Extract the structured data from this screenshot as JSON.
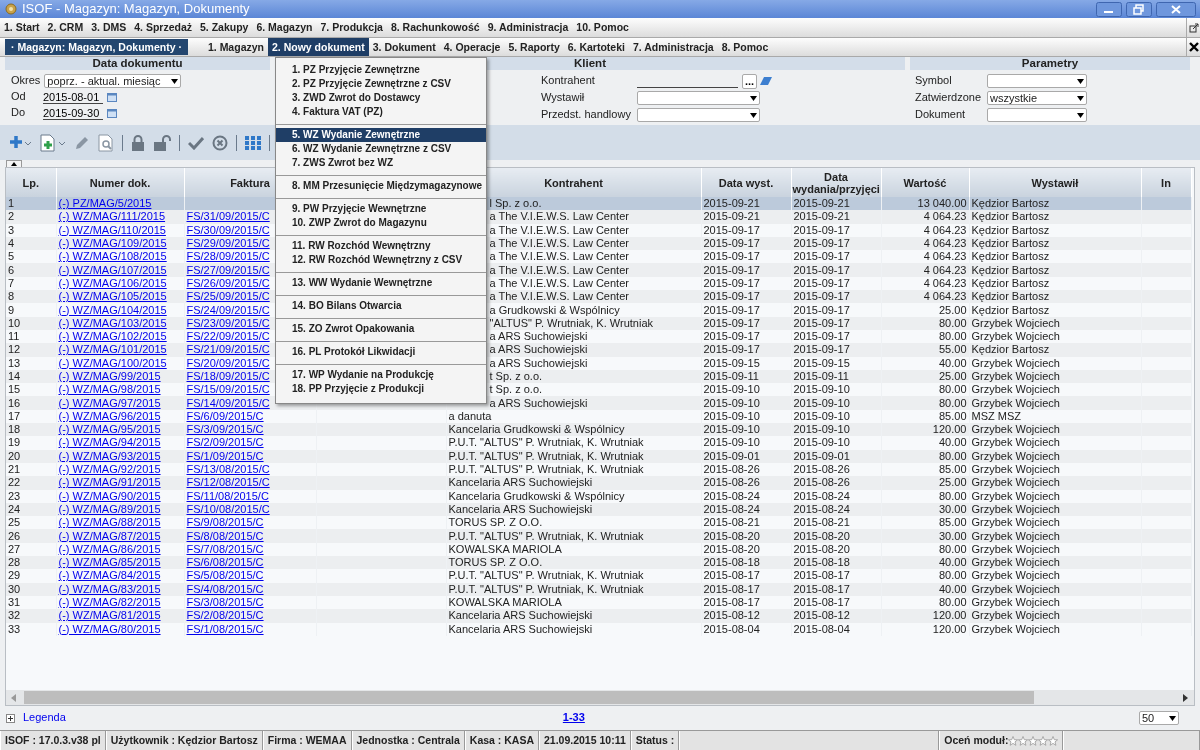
{
  "window": {
    "title": "ISOF - Magazyn: Magazyn, Dokumenty"
  },
  "main_menu": [
    "1. Start",
    "2. CRM",
    "3. DMS",
    "4. Sprzedaż",
    "5. Zakupy",
    "6. Magazyn",
    "7. Produkcja",
    "8. Rachunkowość",
    "9. Administracja",
    "10. Pomoc"
  ],
  "module_tag": "· Magazyn: Magazyn, Dokumenty ·",
  "sub_menu": [
    {
      "label": "1. Magazyn",
      "selected": false
    },
    {
      "label": "2. Nowy dokument",
      "selected": true
    },
    {
      "label": "3. Dokument",
      "selected": false
    },
    {
      "label": "4. Operacje",
      "selected": false
    },
    {
      "label": "5. Raporty",
      "selected": false
    },
    {
      "label": "6. Kartoteki",
      "selected": false
    },
    {
      "label": "7. Administracja",
      "selected": false
    },
    {
      "label": "8. Pomoc",
      "selected": false
    }
  ],
  "dropdown": {
    "groups": [
      [
        {
          "label": "1. PZ Przyjęcie Zewnętrzne",
          "selected": false
        },
        {
          "label": "2. PZ Przyjęcie Zewnętrzne z CSV",
          "selected": false
        },
        {
          "label": "3. ZWD Zwrot do Dostawcy",
          "selected": false
        },
        {
          "label": "4. Faktura VAT (PZ)",
          "selected": false
        }
      ],
      [
        {
          "label": "5. WZ Wydanie Zewnętrzne",
          "selected": true
        },
        {
          "label": "6. WZ Wydanie Zewnętrzne z CSV",
          "selected": false
        },
        {
          "label": "7. ZWS Zwrot bez WZ",
          "selected": false
        }
      ],
      [
        {
          "label": "8. MM Przesunięcie Międzymagazynowe",
          "selected": false
        }
      ],
      [
        {
          "label": "9. PW Przyjęcie Wewnętrzne",
          "selected": false
        },
        {
          "label": "10. ZWP Zwrot do Magazynu",
          "selected": false
        }
      ],
      [
        {
          "label": "11. RW Rozchód Wewnętrzny",
          "selected": false
        },
        {
          "label": "12. RW Rozchód Wewnętrzny z CSV",
          "selected": false
        }
      ],
      [
        {
          "label": "13. WW Wydanie Wewnętrzne",
          "selected": false
        }
      ],
      [
        {
          "label": "14. BO Bilans Otwarcia",
          "selected": false
        }
      ],
      [
        {
          "label": "15. ZO Zwrot Opakowania",
          "selected": false
        }
      ],
      [
        {
          "label": "16. PL Protokół Likwidacji",
          "selected": false
        }
      ],
      [
        {
          "label": "17. WP Wydanie na Produkcję",
          "selected": false
        },
        {
          "label": "18. PP Przyjęcie z Produkcji",
          "selected": false
        }
      ]
    ]
  },
  "filters": {
    "date": {
      "title": "Data dokumentu",
      "period_label": "Okres",
      "period": "poprz. - aktual. miesiąc",
      "from_label": "Od",
      "from": "2015-08-01",
      "to_label": "Do",
      "to": "2015-09-30"
    },
    "client": {
      "title": "Klient",
      "fields": [
        {
          "label": "Kontrahent",
          "kind": "lookup",
          "button": "..."
        },
        {
          "label": "Wystawił",
          "kind": "select"
        },
        {
          "label": "Przedst. handlowy",
          "kind": "select"
        }
      ]
    },
    "params": {
      "title": "Parametry",
      "fields": [
        {
          "label": "Symbol",
          "kind": "select"
        },
        {
          "label": "Zatwierdzone",
          "kind": "select",
          "value": "wszystkie"
        },
        {
          "label": "Dokument",
          "kind": "select"
        }
      ]
    }
  },
  "table": {
    "columns": [
      {
        "label": "Lp.",
        "kind": "text"
      },
      {
        "label": "Numer dok.",
        "kind": "link"
      },
      {
        "label": "Faktura",
        "kind": "link"
      },
      {
        "kind": "blank"
      },
      {
        "label": "Kontrahent",
        "kind": "text"
      },
      {
        "label": "Data wyst.",
        "kind": "text"
      },
      {
        "label": "Data wydania/przyjęci",
        "kind": "text"
      },
      {
        "label": "Wartość",
        "kind": "number"
      },
      {
        "label": "Wystawił",
        "kind": "text"
      },
      {
        "label": "In",
        "kind": "text"
      }
    ],
    "rows": [
      {
        "cells": [
          "1",
          "(-) PZ/MAG/5/2015",
          null,
          null,
          "l Sp. z o.o.",
          "2015-09-21",
          "2015-09-21",
          "13 040.00",
          "Kędzior Bartosz"
        ],
        "selected": true
      },
      {
        "cells": [
          "2",
          "(-) WZ/MAG/111/2015",
          "FS/31/09/2015/C",
          null,
          "a The V.I.E.W.S. Law Center",
          "2015-09-21",
          "2015-09-21",
          "4 064.23",
          "Kędzior Bartosz"
        ],
        "selected": false
      },
      {
        "cells": [
          "3",
          "(-) WZ/MAG/110/2015",
          "FS/30/09/2015/C",
          null,
          "a The V.I.E.W.S. Law Center",
          "2015-09-17",
          "2015-09-17",
          "4 064.23",
          "Kędzior Bartosz"
        ],
        "selected": false
      },
      {
        "cells": [
          "4",
          "(-) WZ/MAG/109/2015",
          "FS/29/09/2015/C",
          null,
          "a The V.I.E.W.S. Law Center",
          "2015-09-17",
          "2015-09-17",
          "4 064.23",
          "Kędzior Bartosz"
        ],
        "selected": false
      },
      {
        "cells": [
          "5",
          "(-) WZ/MAG/108/2015",
          "FS/28/09/2015/C",
          null,
          "a The V.I.E.W.S. Law Center",
          "2015-09-17",
          "2015-09-17",
          "4 064.23",
          "Kędzior Bartosz"
        ],
        "selected": false
      },
      {
        "cells": [
          "6",
          "(-) WZ/MAG/107/2015",
          "FS/27/09/2015/C",
          null,
          "a The V.I.E.W.S. Law Center",
          "2015-09-17",
          "2015-09-17",
          "4 064.23",
          "Kędzior Bartosz"
        ],
        "selected": false
      },
      {
        "cells": [
          "7",
          "(-) WZ/MAG/106/2015",
          "FS/26/09/2015/C",
          null,
          "a The V.I.E.W.S. Law Center",
          "2015-09-17",
          "2015-09-17",
          "4 064.23",
          "Kędzior Bartosz"
        ],
        "selected": false
      },
      {
        "cells": [
          "8",
          "(-) WZ/MAG/105/2015",
          "FS/25/09/2015/C",
          null,
          "a The V.I.E.W.S. Law Center",
          "2015-09-17",
          "2015-09-17",
          "4 064.23",
          "Kędzior Bartosz"
        ],
        "selected": false
      },
      {
        "cells": [
          "9",
          "(-) WZ/MAG/104/2015",
          "FS/24/09/2015/C",
          null,
          "a Grudkowski & Wspólnicy",
          "2015-09-17",
          "2015-09-17",
          "25.00",
          "Kędzior Bartosz"
        ],
        "selected": false
      },
      {
        "cells": [
          "10",
          "(-) WZ/MAG/103/2015",
          "FS/23/09/2015/C",
          null,
          "\"ALTUS\" P. Wrutniak, K. Wrutniak",
          "2015-09-17",
          "2015-09-17",
          "80.00",
          "Grzybek Wojciech"
        ],
        "selected": false
      },
      {
        "cells": [
          "11",
          "(-) WZ/MAG/102/2015",
          "FS/22/09/2015/C",
          null,
          "a ARS Suchowiejski",
          "2015-09-17",
          "2015-09-17",
          "80.00",
          "Grzybek Wojciech"
        ],
        "selected": false
      },
      {
        "cells": [
          "12",
          "(-) WZ/MAG/101/2015",
          "FS/21/09/2015/C",
          null,
          "a ARS Suchowiejski",
          "2015-09-17",
          "2015-09-17",
          "55.00",
          "Kędzior Bartosz"
        ],
        "selected": false
      },
      {
        "cells": [
          "13",
          "(-) WZ/MAG/100/2015",
          "FS/20/09/2015/C",
          null,
          "a ARS Suchowiejski",
          "2015-09-15",
          "2015-09-15",
          "40.00",
          "Grzybek Wojciech"
        ],
        "selected": false
      },
      {
        "cells": [
          "14",
          "(-) WZ/MAG/99/2015",
          "FS/18/09/2015/C",
          null,
          "t Sp. z o.o.",
          "2015-09-11",
          "2015-09-11",
          "25.00",
          "Grzybek Wojciech"
        ],
        "selected": false
      },
      {
        "cells": [
          "15",
          "(-) WZ/MAG/98/2015",
          "FS/15/09/2015/C",
          null,
          "t Sp. z o.o.",
          "2015-09-10",
          "2015-09-10",
          "80.00",
          "Grzybek Wojciech"
        ],
        "selected": false
      },
      {
        "cells": [
          "16",
          "(-) WZ/MAG/97/2015",
          "FS/14/09/2015/C",
          null,
          "a ARS Suchowiejski",
          "2015-09-10",
          "2015-09-10",
          "80.00",
          "Grzybek Wojciech"
        ],
        "selected": false
      },
      {
        "cells": [
          "17",
          "(-) WZ/MAG/96/2015",
          "FS/6/09/2015/C",
          null,
          "a danuta",
          "2015-09-10",
          "2015-09-10",
          "85.00",
          "MSZ MSZ"
        ],
        "selected": false
      },
      {
        "cells": [
          "18",
          "(-) WZ/MAG/95/2015",
          "FS/3/09/2015/C",
          null,
          "Kancelaria Grudkowski & Wspólnicy",
          "2015-09-10",
          "2015-09-10",
          "120.00",
          "Grzybek Wojciech"
        ],
        "selected": false
      },
      {
        "cells": [
          "19",
          "(-) WZ/MAG/94/2015",
          "FS/2/09/2015/C",
          null,
          "P.U.T. \"ALTUS\" P. Wrutniak, K. Wrutniak",
          "2015-09-10",
          "2015-09-10",
          "40.00",
          "Grzybek Wojciech"
        ],
        "selected": false
      },
      {
        "cells": [
          "20",
          "(-) WZ/MAG/93/2015",
          "FS/1/09/2015/C",
          null,
          "P.U.T. \"ALTUS\" P. Wrutniak, K. Wrutniak",
          "2015-09-01",
          "2015-09-01",
          "80.00",
          "Grzybek Wojciech"
        ],
        "selected": false
      },
      {
        "cells": [
          "21",
          "(-) WZ/MAG/92/2015",
          "FS/13/08/2015/C",
          null,
          "P.U.T. \"ALTUS\" P. Wrutniak, K. Wrutniak",
          "2015-08-26",
          "2015-08-26",
          "85.00",
          "Grzybek Wojciech"
        ],
        "selected": false
      },
      {
        "cells": [
          "22",
          "(-) WZ/MAG/91/2015",
          "FS/12/08/2015/C",
          null,
          "Kancelaria ARS Suchowiejski",
          "2015-08-26",
          "2015-08-26",
          "25.00",
          "Grzybek Wojciech"
        ],
        "selected": false
      },
      {
        "cells": [
          "23",
          "(-) WZ/MAG/90/2015",
          "FS/11/08/2015/C",
          null,
          "Kancelaria Grudkowski & Wspólnicy",
          "2015-08-24",
          "2015-08-24",
          "80.00",
          "Grzybek Wojciech"
        ],
        "selected": false
      },
      {
        "cells": [
          "24",
          "(-) WZ/MAG/89/2015",
          "FS/10/08/2015/C",
          null,
          "Kancelaria ARS Suchowiejski",
          "2015-08-24",
          "2015-08-24",
          "30.00",
          "Grzybek Wojciech"
        ],
        "selected": false
      },
      {
        "cells": [
          "25",
          "(-) WZ/MAG/88/2015",
          "FS/9/08/2015/C",
          null,
          "TORUS SP. Z O.O.",
          "2015-08-21",
          "2015-08-21",
          "85.00",
          "Grzybek Wojciech"
        ],
        "selected": false
      },
      {
        "cells": [
          "26",
          "(-) WZ/MAG/87/2015",
          "FS/8/08/2015/C",
          null,
          "P.U.T. \"ALTUS\" P. Wrutniak, K. Wrutniak",
          "2015-08-20",
          "2015-08-20",
          "30.00",
          "Grzybek Wojciech"
        ],
        "selected": false
      },
      {
        "cells": [
          "27",
          "(-) WZ/MAG/86/2015",
          "FS/7/08/2015/C",
          null,
          "KOWALSKA MARIOLA",
          "2015-08-20",
          "2015-08-20",
          "80.00",
          "Grzybek Wojciech"
        ],
        "selected": false
      },
      {
        "cells": [
          "28",
          "(-) WZ/MAG/85/2015",
          "FS/6/08/2015/C",
          null,
          "TORUS SP. Z O.O.",
          "2015-08-18",
          "2015-08-18",
          "40.00",
          "Grzybek Wojciech"
        ],
        "selected": false
      },
      {
        "cells": [
          "29",
          "(-) WZ/MAG/84/2015",
          "FS/5/08/2015/C",
          null,
          "P.U.T. \"ALTUS\" P. Wrutniak, K. Wrutniak",
          "2015-08-17",
          "2015-08-17",
          "80.00",
          "Grzybek Wojciech"
        ],
        "selected": false
      },
      {
        "cells": [
          "30",
          "(-) WZ/MAG/83/2015",
          "FS/4/08/2015/C",
          null,
          "P.U.T. \"ALTUS\" P. Wrutniak, K. Wrutniak",
          "2015-08-17",
          "2015-08-17",
          "40.00",
          "Grzybek Wojciech"
        ],
        "selected": false
      },
      {
        "cells": [
          "31",
          "(-) WZ/MAG/82/2015",
          "FS/3/08/2015/C",
          null,
          "KOWALSKA MARIOLA",
          "2015-08-17",
          "2015-08-17",
          "80.00",
          "Grzybek Wojciech"
        ],
        "selected": false
      },
      {
        "cells": [
          "32",
          "(-) WZ/MAG/81/2015",
          "FS/2/08/2015/C",
          null,
          "Kancelaria ARS Suchowiejski",
          "2015-08-12",
          "2015-08-12",
          "120.00",
          "Grzybek Wojciech"
        ],
        "selected": false
      },
      {
        "cells": [
          "33",
          "(-) WZ/MAG/80/2015",
          "FS/1/08/2015/C",
          null,
          "Kancelaria ARS Suchowiejski",
          "2015-08-04",
          "2015-08-04",
          "120.00",
          "Grzybek Wojciech"
        ],
        "selected": false
      }
    ]
  },
  "footer": {
    "legend": "Legenda",
    "range": "1-33",
    "page_size": "50"
  },
  "status_bar": {
    "segments": [
      "ISOF : 17.0.3.v38 pl",
      "Użytkownik : Kędzior Bartosz",
      "Firma : WEMAA",
      "Jednostka : Centrala",
      "Kasa : KASA",
      "21.09.2015 10:11",
      "Status :"
    ],
    "rating": {
      "label": "Oceń moduł:",
      "stars": 0
    }
  }
}
